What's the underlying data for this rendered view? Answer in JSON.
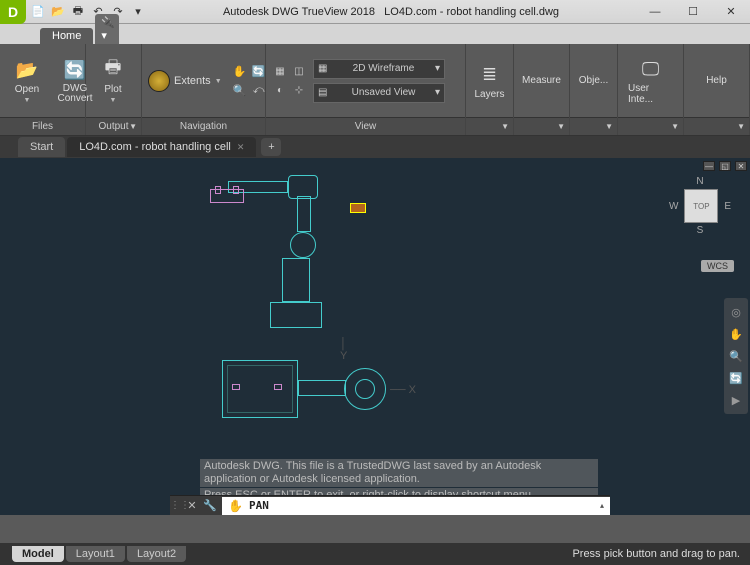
{
  "title": {
    "app": "Autodesk DWG TrueView 2018",
    "doc": "LO4D.com - robot handling cell.dwg"
  },
  "window_controls": {
    "minimize": "—",
    "maximize": "☐",
    "close": "✕"
  },
  "qat_icons": [
    "new-icon",
    "open-icon",
    "plot-icon",
    "undo-icon",
    "redo-icon"
  ],
  "ribbon_tabs": {
    "home": "Home",
    "plugin": "⚙"
  },
  "ribbon": {
    "files": {
      "title": "Files",
      "open": "Open",
      "dwg_convert": "DWG Convert"
    },
    "output": {
      "title": "Output",
      "plot": "Plot"
    },
    "navigation": {
      "title": "Navigation",
      "extents": "Extents",
      "small_tools": [
        "pan-icon",
        "orbit-icon",
        "zoom-window-icon",
        "zoom-prev-icon"
      ]
    },
    "view": {
      "title": "View",
      "small_tools": [
        "views-icon",
        "viewport-icon",
        "visual-style-icon",
        "ucs-icon"
      ],
      "visual_style": "2D Wireframe",
      "named_view": "Unsaved View"
    },
    "layers": {
      "title": "Layers"
    },
    "measure": {
      "title": "Measure"
    },
    "object": {
      "title": "Obje..."
    },
    "user_interface": {
      "title": "User Inte..."
    },
    "help": {
      "title": "Help"
    }
  },
  "doc_tabs": {
    "start": "Start",
    "active": "LO4D.com - robot handling cell"
  },
  "viewcube": {
    "n": "N",
    "s": "S",
    "e": "E",
    "w": "W",
    "face": "TOP"
  },
  "wcs": "WCS",
  "ucs": {
    "x": "X",
    "y": "Y"
  },
  "nav_tools": [
    "wheel-icon",
    "pan-icon",
    "zoom-icon",
    "orbit-icon",
    "showmotion-icon"
  ],
  "console": {
    "line1": "Autodesk DWG.  This file is a TrustedDWG last saved by an Autodesk application or Autodesk licensed application.",
    "line2": "Press ESC or ENTER to exit, or right-click to display shortcut menu."
  },
  "command": {
    "tool_icons": [
      "close-icon",
      "wrench-icon"
    ],
    "hand": "✋",
    "text": "PAN"
  },
  "layout_tabs": {
    "model": "Model",
    "layout1": "Layout1",
    "layout2": "Layout2"
  },
  "status": "Press pick button and drag to pan."
}
